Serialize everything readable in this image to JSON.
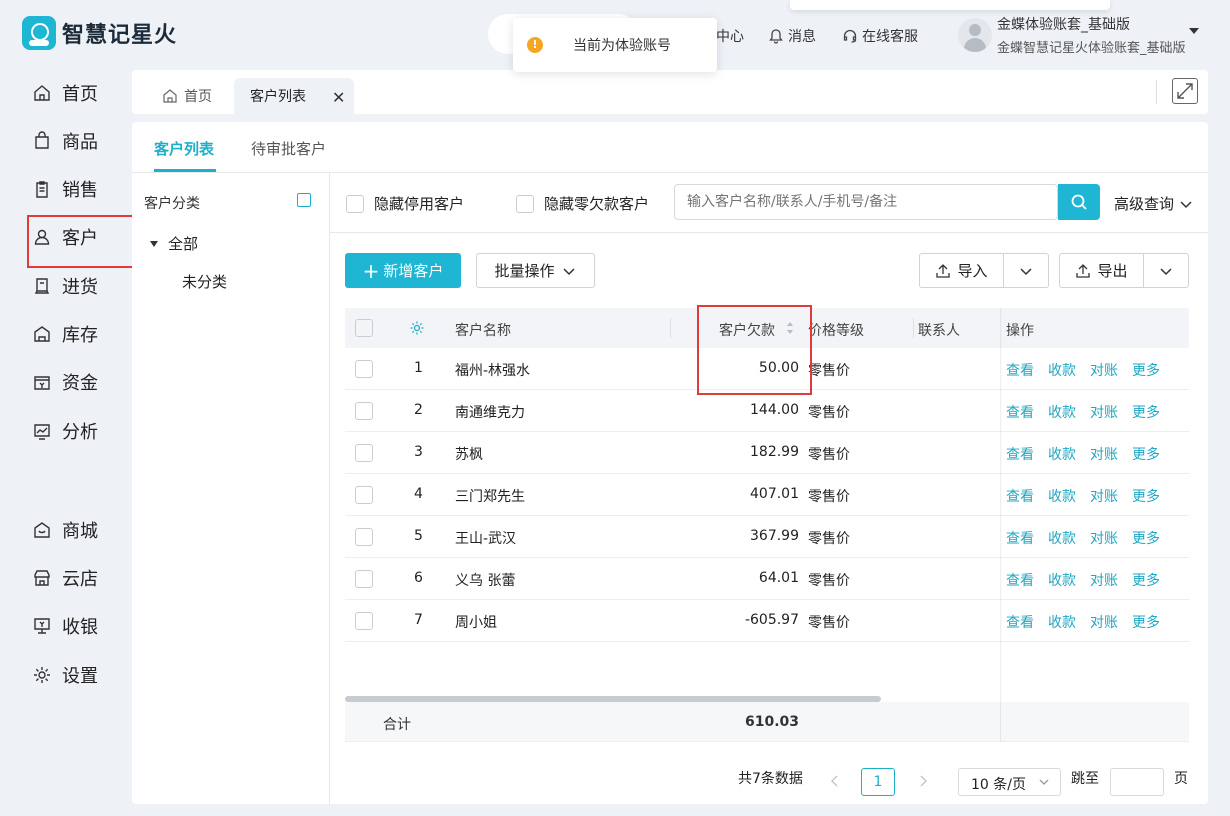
{
  "app": {
    "name": "智慧记星火"
  },
  "toast": {
    "text": "当前为体验账号"
  },
  "topnav": {
    "center": "中心",
    "messages": "消息",
    "support": "在线客服"
  },
  "user": {
    "name": "金蝶体验账套_基础版",
    "subtitle": "金蝶智慧记星火体验账套_基础版"
  },
  "sidebar": {
    "items": [
      {
        "label": "首页",
        "icon": "home-icon"
      },
      {
        "label": "商品",
        "icon": "bag-icon"
      },
      {
        "label": "销售",
        "icon": "clipboard-icon"
      },
      {
        "label": "客户",
        "icon": "user-icon",
        "selected": true
      },
      {
        "label": "进货",
        "icon": "book-icon"
      },
      {
        "label": "库存",
        "icon": "warehouse-icon"
      },
      {
        "label": "资金",
        "icon": "wallet-icon"
      },
      {
        "label": "分析",
        "icon": "chart-icon"
      },
      {
        "label": "商城",
        "icon": "shop-icon"
      },
      {
        "label": "云店",
        "icon": "store-icon"
      },
      {
        "label": "收银",
        "icon": "cashier-icon"
      },
      {
        "label": "设置",
        "icon": "gear-icon"
      }
    ]
  },
  "tabs": {
    "home": "首页",
    "active": "客户列表"
  },
  "subtabs": {
    "list": "客户列表",
    "pending": "待审批客户"
  },
  "category": {
    "title": "客户分类",
    "all": "全部",
    "uncategorized": "未分类"
  },
  "filters": {
    "hide_disabled": "隐藏停用客户",
    "hide_zero_debt": "隐藏零欠款客户",
    "search_placeholder": "输入客户名称/联系人/手机号/备注",
    "advanced": "高级查询"
  },
  "toolbar": {
    "add": "新增客户",
    "batch": "批量操作",
    "import": "导入",
    "export": "导出"
  },
  "table": {
    "headers": {
      "name": "客户名称",
      "debt": "客户欠款",
      "price_level": "价格等级",
      "contact": "联系人",
      "actions": "操作"
    },
    "actions": [
      "查看",
      "收款",
      "对账",
      "更多"
    ],
    "rows": [
      {
        "no": "1",
        "name": "福州-林强水",
        "debt": "50.00",
        "price_level": "零售价",
        "contact": ""
      },
      {
        "no": "2",
        "name": "南通维克力",
        "debt": "144.00",
        "price_level": "零售价",
        "contact": ""
      },
      {
        "no": "3",
        "name": "苏枫",
        "debt": "182.99",
        "price_level": "零售价",
        "contact": ""
      },
      {
        "no": "4",
        "name": "三门郑先生",
        "debt": "407.01",
        "price_level": "零售价",
        "contact": ""
      },
      {
        "no": "5",
        "name": "王山-武汉",
        "debt": "367.99",
        "price_level": "零售价",
        "contact": ""
      },
      {
        "no": "6",
        "name": "义乌 张蕾",
        "debt": "64.01",
        "price_level": "零售价",
        "contact": ""
      },
      {
        "no": "7",
        "name": "周小姐",
        "debt": "-605.97",
        "price_level": "零售价",
        "contact": ""
      }
    ],
    "total_label": "合计",
    "total_debt": "610.03"
  },
  "pagination": {
    "summary": "共7条数据",
    "current": "1",
    "page_size": "10 条/页",
    "jump_label": "跳至",
    "page_unit": "页"
  },
  "colors": {
    "accent": "#1fb6d4",
    "highlight": "#e03a3a",
    "link": "#1fa7c4"
  }
}
